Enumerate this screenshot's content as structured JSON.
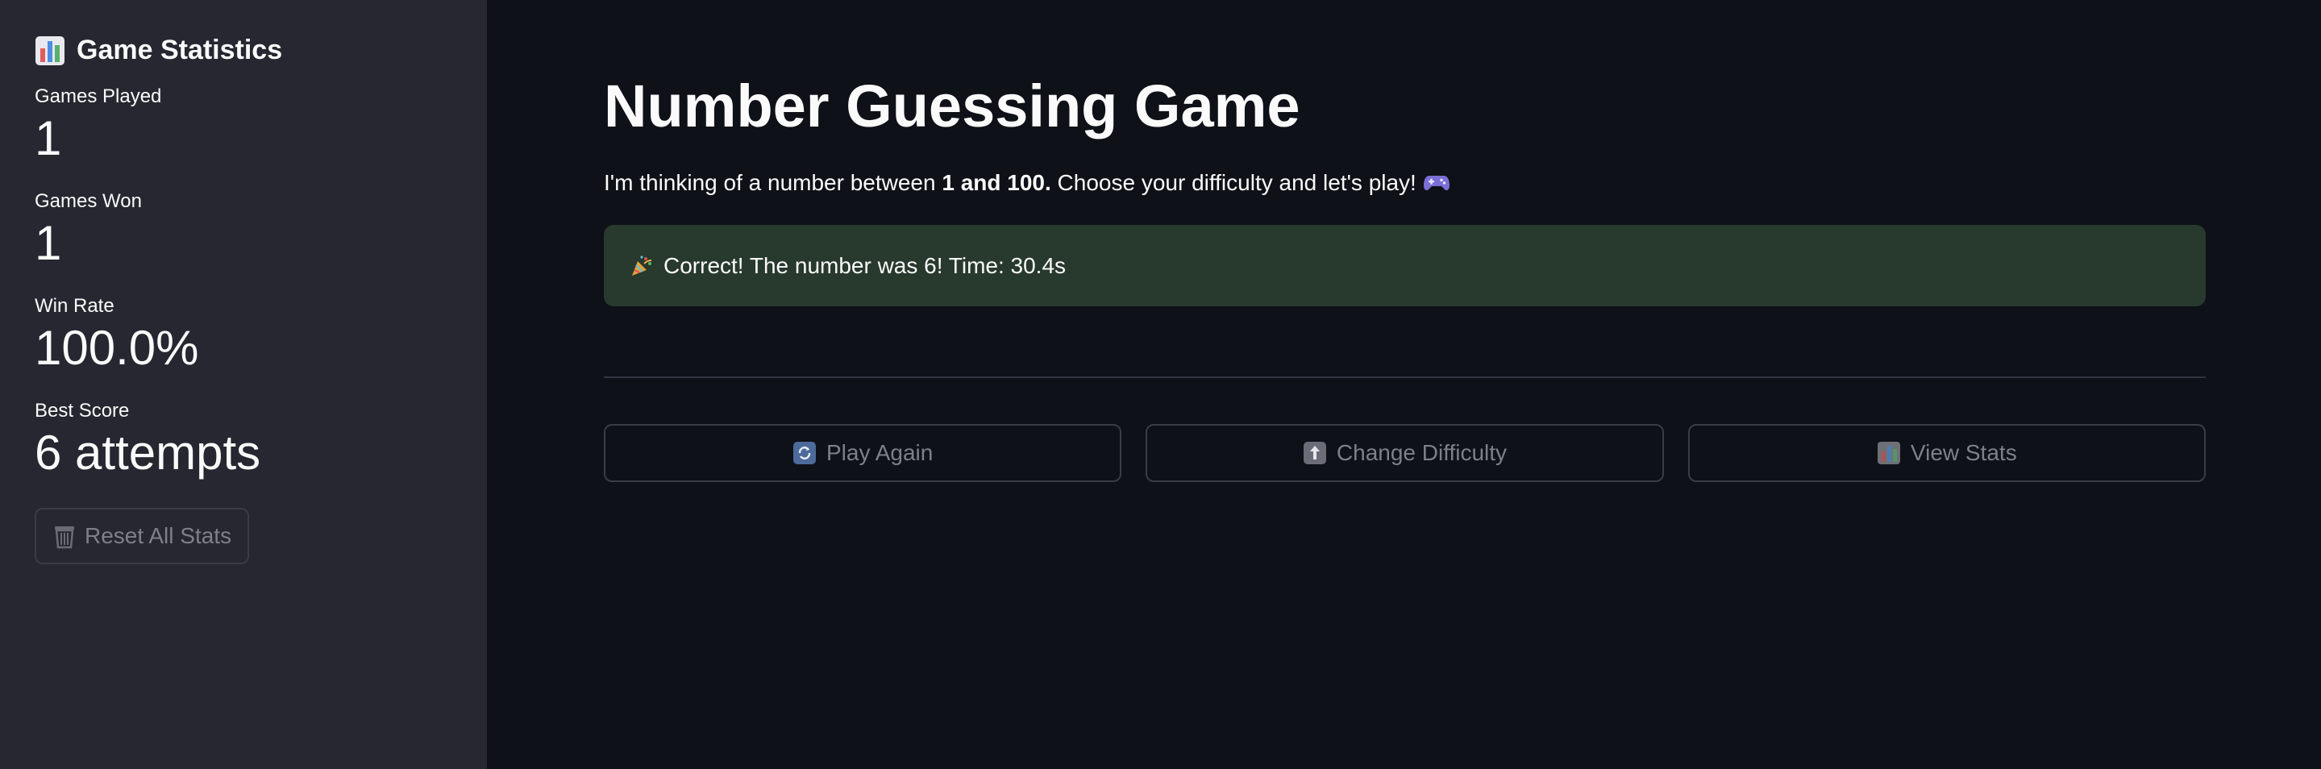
{
  "sidebar": {
    "title": "Game Statistics",
    "title_icon": "bar-chart-icon",
    "metrics": [
      {
        "label": "Games Played",
        "value": "1"
      },
      {
        "label": "Games Won",
        "value": "1"
      },
      {
        "label": "Win Rate",
        "value": "100.0%"
      },
      {
        "label": "Best Score",
        "value": "6 attempts"
      }
    ],
    "reset_button": {
      "label": "Reset All Stats",
      "icon": "wastebasket-icon"
    }
  },
  "main": {
    "title": "Number Guessing Game",
    "intro": {
      "prefix": "I'm thinking of a number between ",
      "range": "1 and 100.",
      "suffix": " Choose your difficulty and let's play!",
      "icon": "game-controller-icon"
    },
    "alert": {
      "icon": "party-popper-icon",
      "text": "Correct! The number was 6! Time: 30.4s"
    },
    "buttons": [
      {
        "label": "Play Again",
        "icon": "refresh-icon"
      },
      {
        "label": "Change Difficulty",
        "icon": "upload-icon"
      },
      {
        "label": "View Stats",
        "icon": "bar-chart-icon"
      }
    ]
  },
  "colors": {
    "background": "#0e1117",
    "sidebar": "#262730",
    "success_bg": "#28392d",
    "text": "#fafafa",
    "muted": "#7e8088"
  }
}
